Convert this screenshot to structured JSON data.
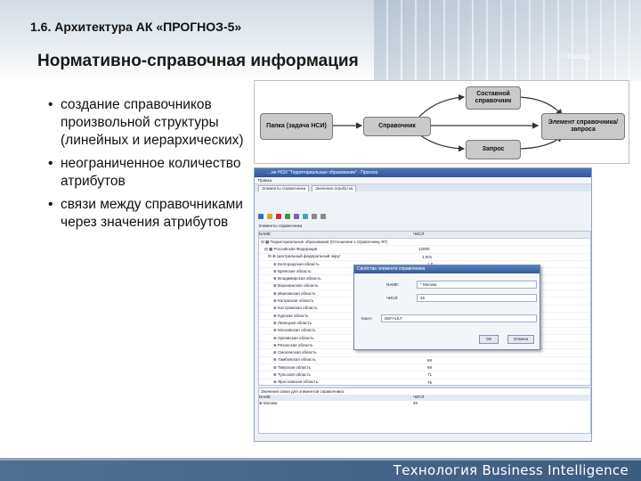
{
  "slide": {
    "section_title": "1.6. Архитектура АК «ПРОГНОЗ-5»",
    "main_title": "Нормативно-справочная информация",
    "back_link": "<<Назад",
    "bullets": [
      "создание справочников произвольной структуры (линейных и иерархических)",
      "неограниченное количество атрибутов",
      "связи между справочниками через значения атрибутов"
    ],
    "footer_text": "Технология Business Intelligence"
  },
  "diagram": {
    "nodes": {
      "folder": "Папка (задача НСИ)",
      "directory": "Справочник",
      "composite": "Составной справочник",
      "element": "Элемент справочника/запроса",
      "query": "Запрос"
    }
  },
  "app": {
    "title": "…ие НСИ \"Территориальные образования\" - Прогноз",
    "menu": "Правка",
    "tabs": [
      "Элементы справочника",
      "Значения атрибутов"
    ],
    "grid_title": "Элементы справочника",
    "columns": [
      "NAME",
      "ЧИСЛ"
    ],
    "rows": [
      {
        "name": "⊟ ▦ Территориальные образования (Отношение к справочнику ЯТ)",
        "code": ""
      },
      {
        "name": "⊟ ▦ Российская Федерация",
        "code": "12000"
      },
      {
        "name": "⊟ ⊕ Центральный федеральный округ",
        "code": "1,001"
      },
      {
        "name": "⊕ Белгородская область",
        "code": "1,0"
      },
      {
        "name": "⊕ Брянская область",
        "code": ""
      },
      {
        "name": "⊕ Владимирская область",
        "code": ""
      },
      {
        "name": "⊕ Воронежская область",
        "code": ""
      },
      {
        "name": "⊕ Ивановская область",
        "code": ""
      },
      {
        "name": "⊕ Калужская область",
        "code": ""
      },
      {
        "name": "⊕ Костромская область",
        "code": ""
      },
      {
        "name": "⊕ Курская область",
        "code": ""
      },
      {
        "name": "⊕ Липецкая область",
        "code": ""
      },
      {
        "name": "⊕ Московская область",
        "code": ""
      },
      {
        "name": "⊕ Орловская область",
        "code": ""
      },
      {
        "name": "⊕ Рязанская область",
        "code": ""
      },
      {
        "name": "⊕ Смоленская область",
        "code": ""
      },
      {
        "name": "⊕ Тамбовская область",
        "code": "68"
      },
      {
        "name": "⊕ Тверская область",
        "code": "69"
      },
      {
        "name": "⊕ Тульская область",
        "code": "71"
      },
      {
        "name": "⊕ Ярославская область",
        "code": "76"
      },
      {
        "name": "⊕ Москва",
        "code": "45"
      }
    ],
    "sub_title": "Значения связи для элементов справочника:",
    "sub_columns": [
      "NAME",
      "ЧИСЛ"
    ],
    "sub_rows": [
      {
        "name": "⊕ Москва",
        "code": "45"
      }
    ],
    "dialog": {
      "title": "Свойства элемента справочника",
      "fields": [
        {
          "label": "NAME:",
          "value": "* Москва"
        },
        {
          "label": "ЧИСЛ:",
          "value": "45"
        },
        {
          "label": "Ключ:",
          "value": "DEFAULT"
        }
      ],
      "ok": "ОК",
      "cancel": "Отмена"
    }
  }
}
